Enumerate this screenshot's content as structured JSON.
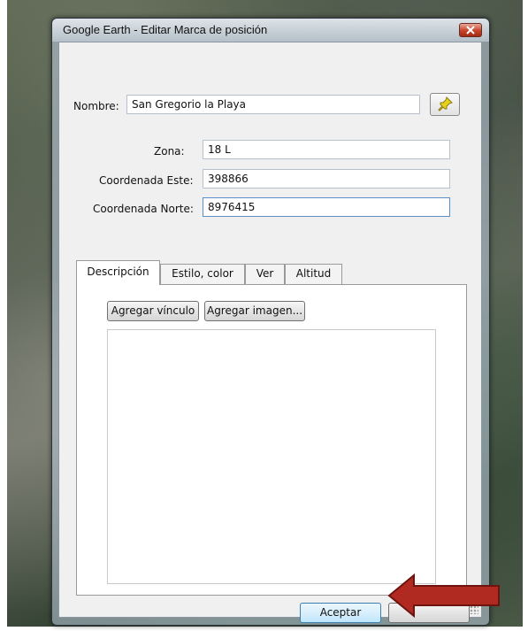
{
  "window": {
    "title": "Google Earth - Editar Marca de posición"
  },
  "form": {
    "name_label": "Nombre:",
    "name_value": "San Gregorio la Playa",
    "zone_label": "Zona:",
    "zone_value": "18 L",
    "east_label": "Coordenada Este:",
    "east_value": "398866",
    "north_label": "Coordenada Norte:",
    "north_value": "8976415"
  },
  "tabs": [
    {
      "label": "Descripción",
      "active": true
    },
    {
      "label": "Estilo, color",
      "active": false
    },
    {
      "label": "Ver",
      "active": false
    },
    {
      "label": "Altitud",
      "active": false
    }
  ],
  "description": {
    "add_link_label": "Agregar vínculo",
    "add_image_label": "Agregar imagen..."
  },
  "footer": {
    "ok_label": "Aceptar",
    "cancel_label": ""
  },
  "icons": {
    "placemark": "pushpin-icon",
    "close": "close-icon",
    "annotation": "red-arrow-icon"
  },
  "colors": {
    "close_button": "#c6432a",
    "pushpin": "#e6d21e",
    "annotation_arrow": "#b02a22"
  }
}
